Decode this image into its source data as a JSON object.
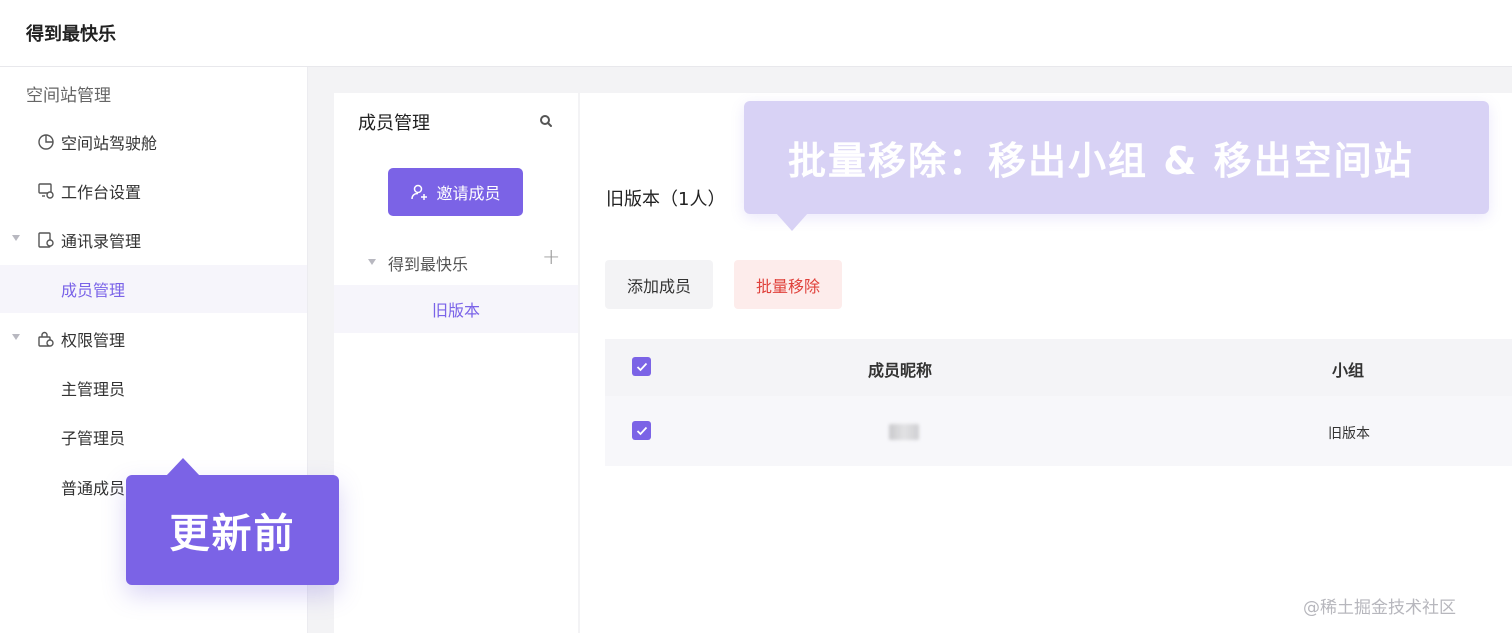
{
  "header": {
    "title": "得到最快乐"
  },
  "sidebar": {
    "section_title": "空间站管理",
    "items": [
      {
        "label": "空间站驾驶舱",
        "icon": "pie-chart-icon",
        "expandable": false,
        "active": false
      },
      {
        "label": "工作台设置",
        "icon": "workbench-settings-icon",
        "expandable": false,
        "active": false
      },
      {
        "label": "通讯录管理",
        "icon": "contacts-icon",
        "expandable": true,
        "active": false
      },
      {
        "label": "成员管理",
        "icon": "",
        "expandable": false,
        "active": true
      },
      {
        "label": "权限管理",
        "icon": "permission-lock-icon",
        "expandable": true,
        "active": false
      },
      {
        "label": "主管理员",
        "icon": "",
        "expandable": false,
        "active": false
      },
      {
        "label": "子管理员",
        "icon": "",
        "expandable": false,
        "active": false
      },
      {
        "label": "普通成员",
        "icon": "",
        "expandable": false,
        "active": false
      }
    ]
  },
  "member_panel": {
    "title": "成员管理",
    "search_icon": "search-icon",
    "invite_label": "邀请成员",
    "tree_root": "得到最快乐",
    "tree_child": "旧版本"
  },
  "main": {
    "group_heading": "旧版本（1人）",
    "add_member_label": "添加成员",
    "bulk_remove_label": "批量移除",
    "table": {
      "columns": [
        "成员昵称",
        "小组"
      ],
      "rows": [
        {
          "nickname_blurred": true,
          "group": "旧版本",
          "checked": true
        }
      ],
      "header_checked": true
    }
  },
  "callouts": {
    "top": "批量移除：移出小组 & 移出空间站",
    "left": "更新前"
  },
  "watermark": "@稀土掘金技术社区",
  "colors": {
    "accent": "#7b63e6",
    "accent_light": "#d8d2f5",
    "danger": "#e0413b",
    "danger_bg": "#fdeceb"
  }
}
